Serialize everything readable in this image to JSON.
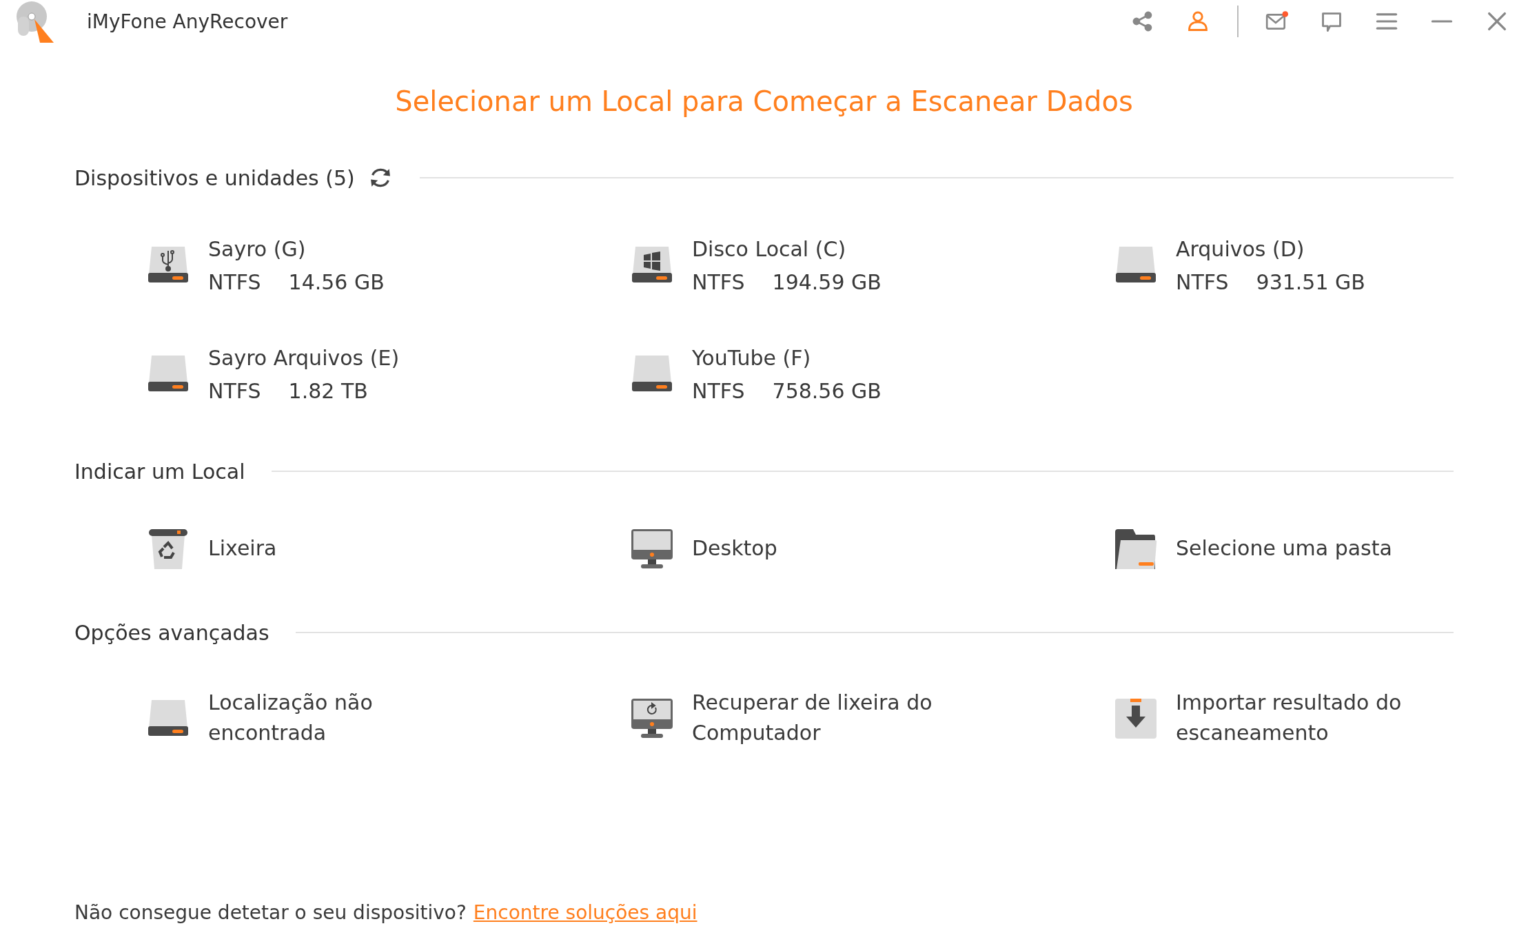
{
  "window": {
    "title": "iMyFone AnyRecover",
    "mail_unread": true
  },
  "heading": "Selecionar um Local para Começar a Escanear Dados",
  "sections": [
    {
      "title": "Dispositivos e unidades (5)",
      "items": [
        {
          "kind": "drive",
          "name": "Sayro (G)",
          "fs": "NTFS",
          "size": "14.56 GB"
        },
        {
          "kind": "drive",
          "name": "Disco Local (C)",
          "fs": "NTFS",
          "size": "194.59 GB"
        },
        {
          "kind": "drive",
          "name": "Arquivos (D)",
          "fs": "NTFS",
          "size": "931.51 GB"
        },
        {
          "kind": "drive",
          "name": "Sayro Arquivos (E)",
          "fs": "NTFS",
          "size": "1.82 TB"
        },
        {
          "kind": "drive",
          "name": "YouTube (F)",
          "fs": "NTFS",
          "size": "758.56 GB"
        }
      ]
    },
    {
      "title": "Indicar um Local",
      "items": [
        {
          "kind": "location",
          "name": "Lixeira"
        },
        {
          "kind": "location",
          "name": "Desktop"
        },
        {
          "kind": "location",
          "name": "Selecione uma pasta"
        }
      ]
    },
    {
      "title": "Opções avançadas",
      "items": [
        {
          "kind": "location",
          "name": "Localização não encontrada"
        },
        {
          "kind": "location",
          "name": "Recuperar de lixeira do Computador"
        },
        {
          "kind": "location",
          "name": "Importar resultado do escaneamento"
        }
      ]
    }
  ],
  "footer": {
    "text": "Não consegue detetar o seu dispositivo?",
    "link": "Encontre soluções aqui"
  }
}
